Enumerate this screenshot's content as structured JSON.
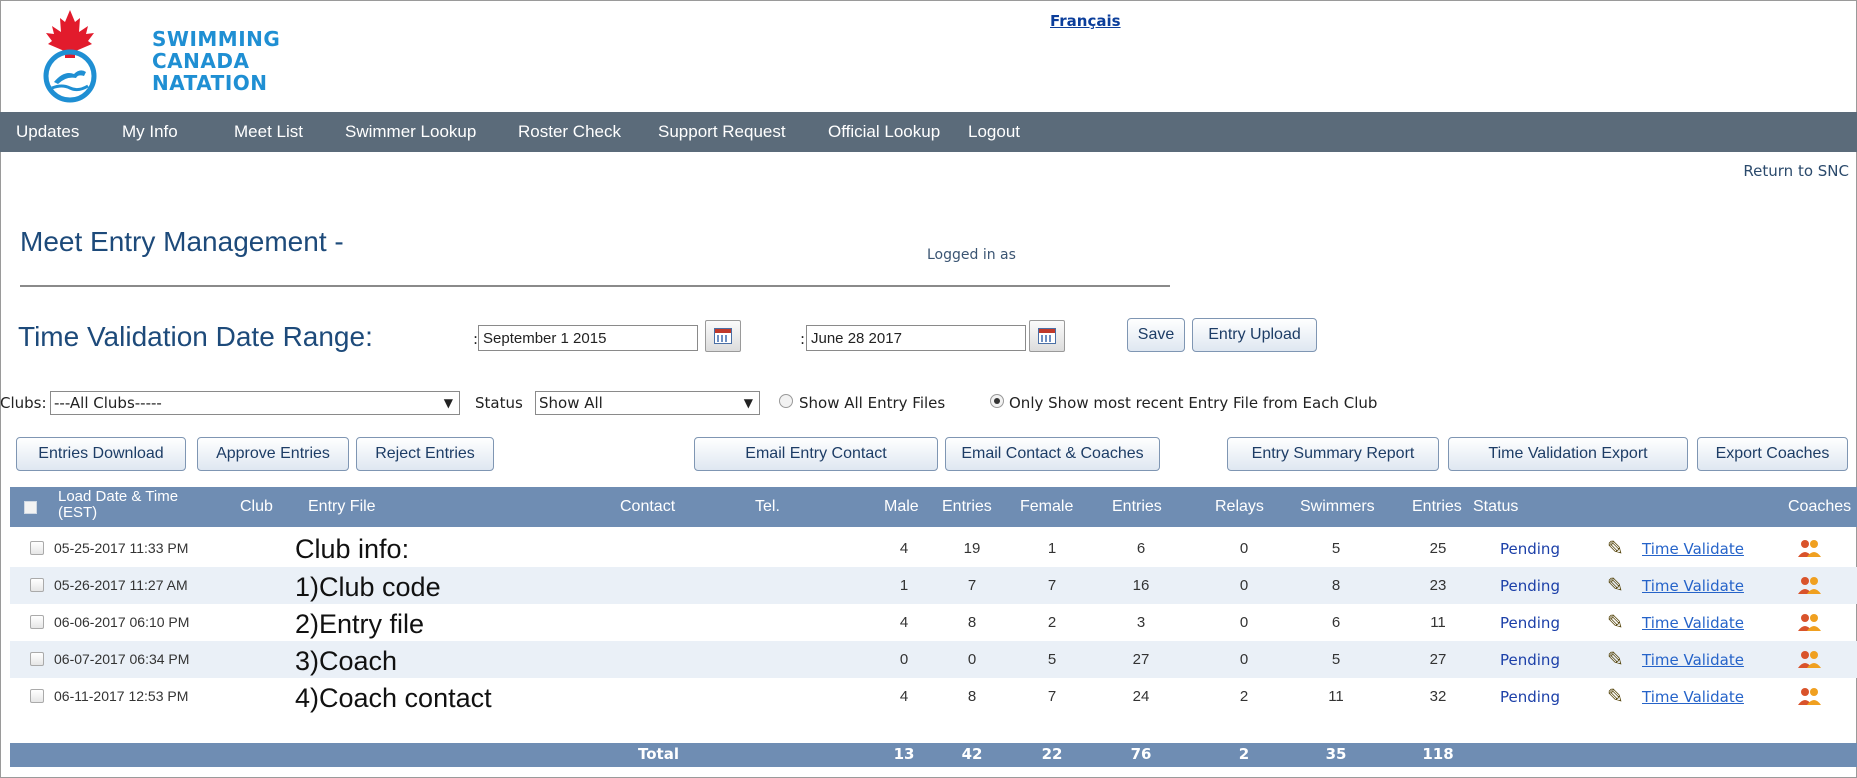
{
  "header": {
    "logo_lines": [
      "SWIMMING",
      "CANADA",
      "NATATION"
    ],
    "language_link": "Français",
    "return_link": "Return to SNC"
  },
  "nav": [
    "Updates",
    "My Info",
    "Meet List",
    "Swimmer Lookup",
    "Roster Check",
    "Support Request",
    "Official Lookup",
    "Logout"
  ],
  "page": {
    "title": "Meet Entry Management -",
    "logged_in": "Logged in as"
  },
  "date_range": {
    "title": "Time Validation Date Range:",
    "colon": ":",
    "start": "September 1 2015",
    "end": "June   28 2017",
    "save_label": "Save",
    "upload_label": "Entry Upload"
  },
  "filters": {
    "clubs_label": "Clubs:",
    "clubs_value": "---All Clubs-----",
    "status_label": "Status",
    "status_value": "Show All",
    "radio_all": "Show All Entry Files",
    "radio_recent": "Only Show most recent Entry File from Each Club",
    "selected_radio": "radio_recent"
  },
  "actions": {
    "entries_download": "Entries Download",
    "approve": "Approve Entries",
    "reject": "Reject Entries",
    "email_contact": "Email Entry Contact",
    "email_coaches": "Email Contact & Coaches",
    "summary": "Entry Summary Report",
    "tv_export": "Time Validation Export",
    "export_coaches": "Export Coaches"
  },
  "table": {
    "headers": {
      "load_date_1": "Load Date & Time",
      "load_date_2": "(EST)",
      "club": "Club",
      "entry_file": "Entry File",
      "contact": "Contact",
      "tel": "Tel.",
      "male": "Male",
      "entries_m": "Entries",
      "female": "Female",
      "entries_f": "Entries",
      "relays": "Relays",
      "swimmers": "Swimmers",
      "entries_t": "Entries",
      "status": "Status",
      "coaches": "Coaches"
    },
    "rows": [
      {
        "date": "05-25-2017 11:33 PM",
        "male": "4",
        "entries_m": "19",
        "female": "1",
        "entries_f": "6",
        "relays": "0",
        "swimmers": "5",
        "entries": "25",
        "status": "Pending",
        "action": "Time Validate"
      },
      {
        "date": "05-26-2017 11:27 AM",
        "male": "1",
        "entries_m": "7",
        "female": "7",
        "entries_f": "16",
        "relays": "0",
        "swimmers": "8",
        "entries": "23",
        "status": "Pending",
        "action": "Time Validate"
      },
      {
        "date": "06-06-2017 06:10 PM",
        "male": "4",
        "entries_m": "8",
        "female": "2",
        "entries_f": "3",
        "relays": "0",
        "swimmers": "6",
        "entries": "11",
        "status": "Pending",
        "action": "Time Validate"
      },
      {
        "date": "06-07-2017 06:34 PM",
        "male": "0",
        "entries_m": "0",
        "female": "5",
        "entries_f": "27",
        "relays": "0",
        "swimmers": "5",
        "entries": "27",
        "status": "Pending",
        "action": "Time Validate"
      },
      {
        "date": "06-11-2017 12:53 PM",
        "male": "4",
        "entries_m": "8",
        "female": "7",
        "entries_f": "24",
        "relays": "2",
        "swimmers": "11",
        "entries": "32",
        "status": "Pending",
        "action": "Time Validate"
      }
    ],
    "total": {
      "label": "Total",
      "male": "13",
      "entries_m": "42",
      "female": "22",
      "entries_f": "76",
      "relays": "2",
      "swimmers": "35",
      "entries": "118"
    }
  },
  "annotation": [
    "Club info:",
    "1)Club code",
    "2)Entry file",
    "3)Coach",
    "4)Coach contact"
  ],
  "colors": {
    "nav_bg": "#5b6b7a",
    "table_header": "#6f8db3",
    "title": "#1d4a7a",
    "logo_blue": "#1f8fd3",
    "maple_red": "#e21b2c"
  }
}
